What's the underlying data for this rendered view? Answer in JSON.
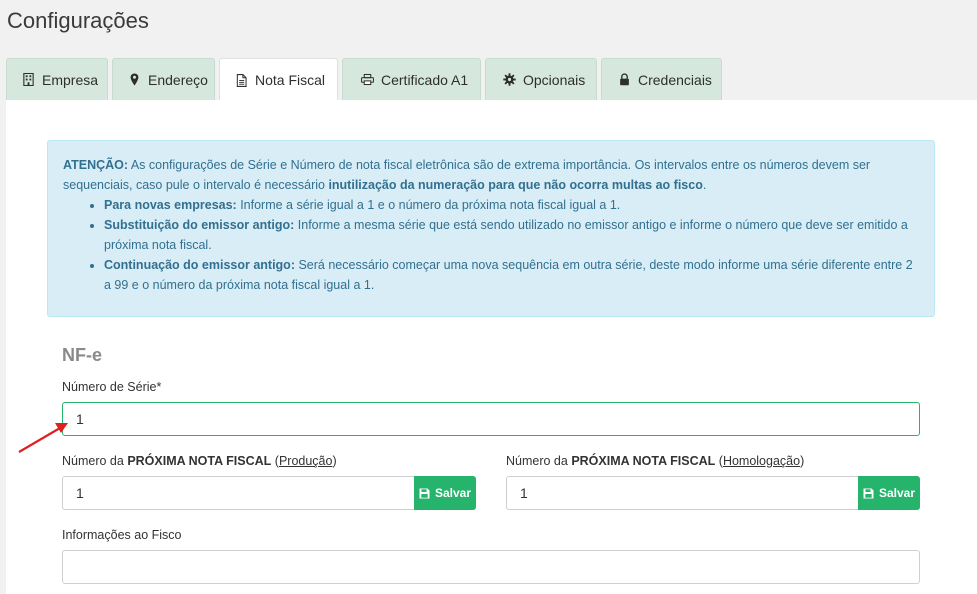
{
  "page": {
    "title": "Configurações"
  },
  "tabs": [
    {
      "label": "Empresa",
      "icon": "building-icon"
    },
    {
      "label": "Endereço",
      "icon": "map-marker-icon"
    },
    {
      "label": "Nota Fiscal",
      "icon": "file-icon",
      "active": true
    },
    {
      "label": "Certificado A1",
      "icon": "printer-icon"
    },
    {
      "label": "Opcionais",
      "icon": "gear-icon"
    },
    {
      "label": "Credenciais",
      "icon": "lock-icon"
    }
  ],
  "alert": {
    "lead_bold": "ATENÇÃO:",
    "lead_text": " As configurações de Série e Número de nota fiscal eletrônica são de extrema importância. Os intervalos entre os números devem ser sequenciais, caso pule o intervalo é necessário ",
    "lead_bold2": "inutilização da numeração para que não ocorra multas ao fisco",
    "lead_end": ".",
    "items": [
      {
        "bold": "Para novas empresas:",
        "text": " Informe a série igual a 1 e o número da próxima nota fiscal igual a 1."
      },
      {
        "bold": "Substituição do emissor antigo:",
        "text": " Informe a mesma série que está sendo utilizado no emissor antigo e informe o número que deve ser emitido a próxima nota fiscal."
      },
      {
        "bold": "Continuação do emissor antigo:",
        "text": " Será necessário começar uma nova sequência em outra série, deste modo informe uma série diferente entre 2 a 99 e o número da próxima nota fiscal igual a 1."
      }
    ]
  },
  "form": {
    "section_title": "NF-e",
    "serie": {
      "label": "Número de Série*",
      "value": "1"
    },
    "prod": {
      "label_pre": "Número da ",
      "label_bold": "PRÓXIMA NOTA FISCAL",
      "label_open": " (",
      "label_u": "Produção",
      "label_close": ")",
      "value": "1",
      "button": "Salvar"
    },
    "homolog": {
      "label_pre": "Número da ",
      "label_bold": "PRÓXIMA NOTA FISCAL",
      "label_open": " (",
      "label_u": "Homologação",
      "label_close": ")",
      "value": "1",
      "button": "Salvar"
    },
    "info": {
      "label": "Informações ao Fisco",
      "value": ""
    }
  },
  "colors": {
    "accent": "#26b36b",
    "alert_bg": "#d9edf7",
    "alert_text": "#31708f",
    "tab_bg": "#d6e8dd",
    "annotation": "#e02020"
  }
}
